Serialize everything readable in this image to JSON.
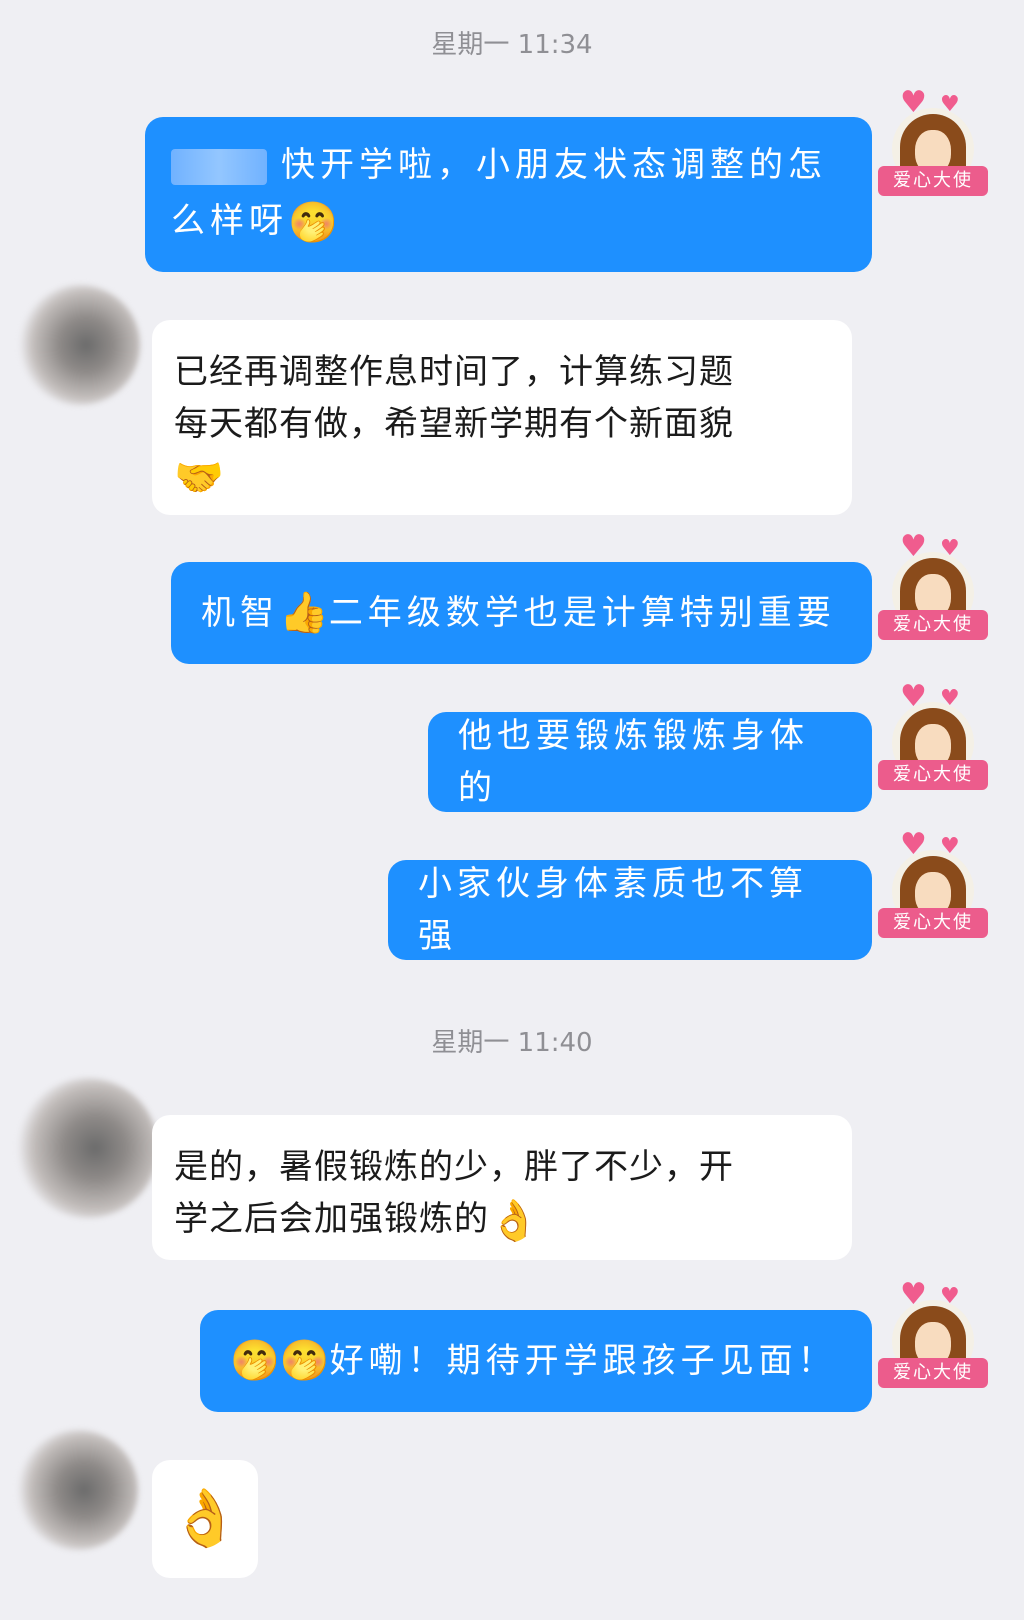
{
  "timestamps": [
    "星期一 11:34",
    "星期一 11:40"
  ],
  "my_avatar": {
    "ribbon_text": "爱心大使",
    "icon": "cartoon-girl-avatar-icon"
  },
  "messages": [
    {
      "sender": "me",
      "line1": "快开学啦，小朋友状态调整的怎",
      "line2": "么样呀",
      "emoji": "🤭"
    },
    {
      "sender": "other",
      "line1": "已经再调整作息时间了，计算练习题",
      "line2": "每天都有做，希望新学期有个新面貌",
      "emoji": "🤝"
    },
    {
      "sender": "me",
      "text_a": "机智",
      "emoji": "👍",
      "text_b": "二年级数学也是计算特别重要"
    },
    {
      "sender": "me",
      "text": "他也要锻炼锻炼身体的"
    },
    {
      "sender": "me",
      "text": "小家伙身体素质也不算强"
    },
    {
      "sender": "other",
      "line1": "是的，暑假锻炼的少，胖了不少，开",
      "line2": "学之后会加强锻炼的",
      "emoji": "👌"
    },
    {
      "sender": "me",
      "emoji": "🤭🤭",
      "text": "好嘞！期待开学跟孩子见面！"
    },
    {
      "sender": "other",
      "emoji": "👌"
    }
  ]
}
